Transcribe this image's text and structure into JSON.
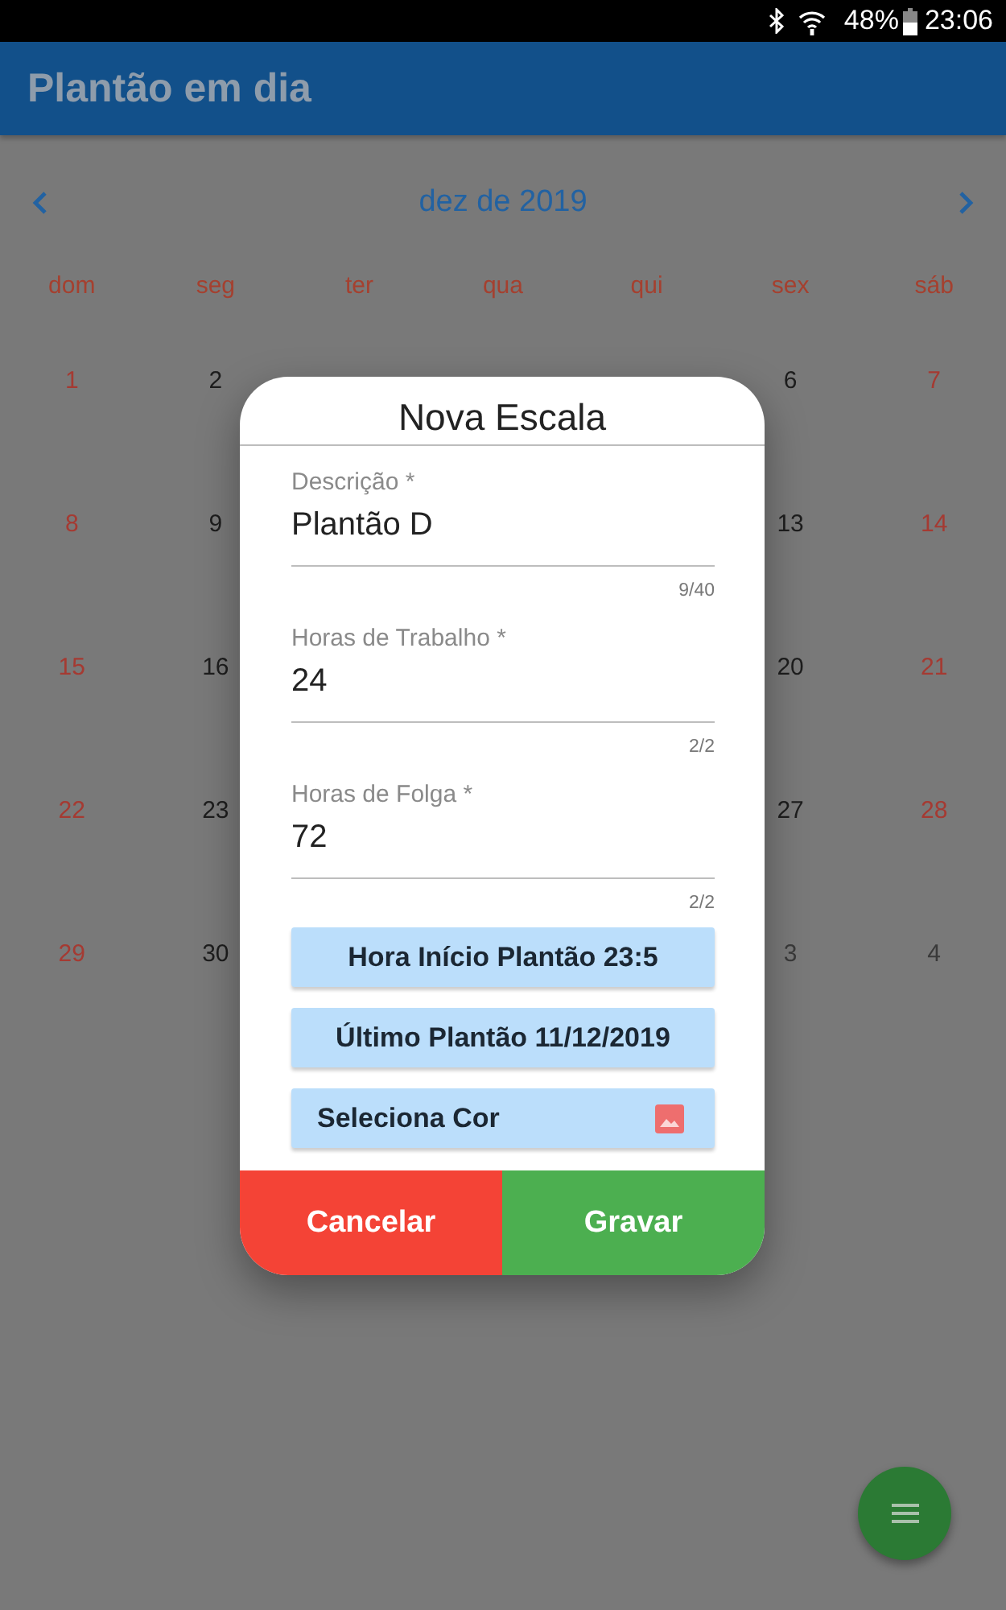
{
  "status_bar": {
    "battery": "48%",
    "time": "23:06"
  },
  "app_bar": {
    "title": "Plantão em dia"
  },
  "calendar": {
    "month": "dez de 2019",
    "weekdays": [
      "dom",
      "seg",
      "ter",
      "qua",
      "qui",
      "sex",
      "sáb"
    ],
    "weeks": [
      {
        "start": [
          {
            "day": "1",
            "kind": "weekend"
          },
          {
            "day": "2",
            "kind": "weekday"
          }
        ],
        "end": [
          {
            "day": "6",
            "kind": "weekday"
          },
          {
            "day": "7",
            "kind": "weekend"
          }
        ]
      },
      {
        "start": [
          {
            "day": "8",
            "kind": "weekend"
          },
          {
            "day": "9",
            "kind": "weekday"
          }
        ],
        "end": [
          {
            "day": "13",
            "kind": "weekday"
          },
          {
            "day": "14",
            "kind": "weekend"
          }
        ]
      },
      {
        "start": [
          {
            "day": "15",
            "kind": "weekend"
          },
          {
            "day": "16",
            "kind": "weekday"
          }
        ],
        "end": [
          {
            "day": "20",
            "kind": "weekday"
          },
          {
            "day": "21",
            "kind": "weekend"
          }
        ]
      },
      {
        "start": [
          {
            "day": "22",
            "kind": "weekend"
          },
          {
            "day": "23",
            "kind": "weekday"
          }
        ],
        "end": [
          {
            "day": "27",
            "kind": "weekday"
          },
          {
            "day": "28",
            "kind": "weekend"
          }
        ]
      },
      {
        "start": [
          {
            "day": "29",
            "kind": "weekend"
          },
          {
            "day": "30",
            "kind": "weekday"
          }
        ],
        "end": [
          {
            "day": "3",
            "kind": "other_month"
          },
          {
            "day": "4",
            "kind": "other_month"
          }
        ]
      }
    ]
  },
  "dialog": {
    "title": "Nova Escala",
    "fields": [
      {
        "label": "Descrição *",
        "value": "Plantão D",
        "counter": "9/40"
      },
      {
        "label": "Horas de Trabalho *",
        "value": "24",
        "counter": "2/2"
      },
      {
        "label": "Horas de Folga *",
        "value": "72",
        "counter": "2/2"
      }
    ],
    "buttons": [
      {
        "label": "Hora Início Plantão 23:5",
        "kind": "time"
      },
      {
        "label": "Último Plantão 11/12/2019",
        "kind": "date"
      },
      {
        "label": "Seleciona Cor",
        "kind": "color"
      }
    ],
    "actions": [
      {
        "label": "Cancelar",
        "kind": "cancel"
      },
      {
        "label": "Gravar",
        "kind": "save"
      }
    ]
  }
}
